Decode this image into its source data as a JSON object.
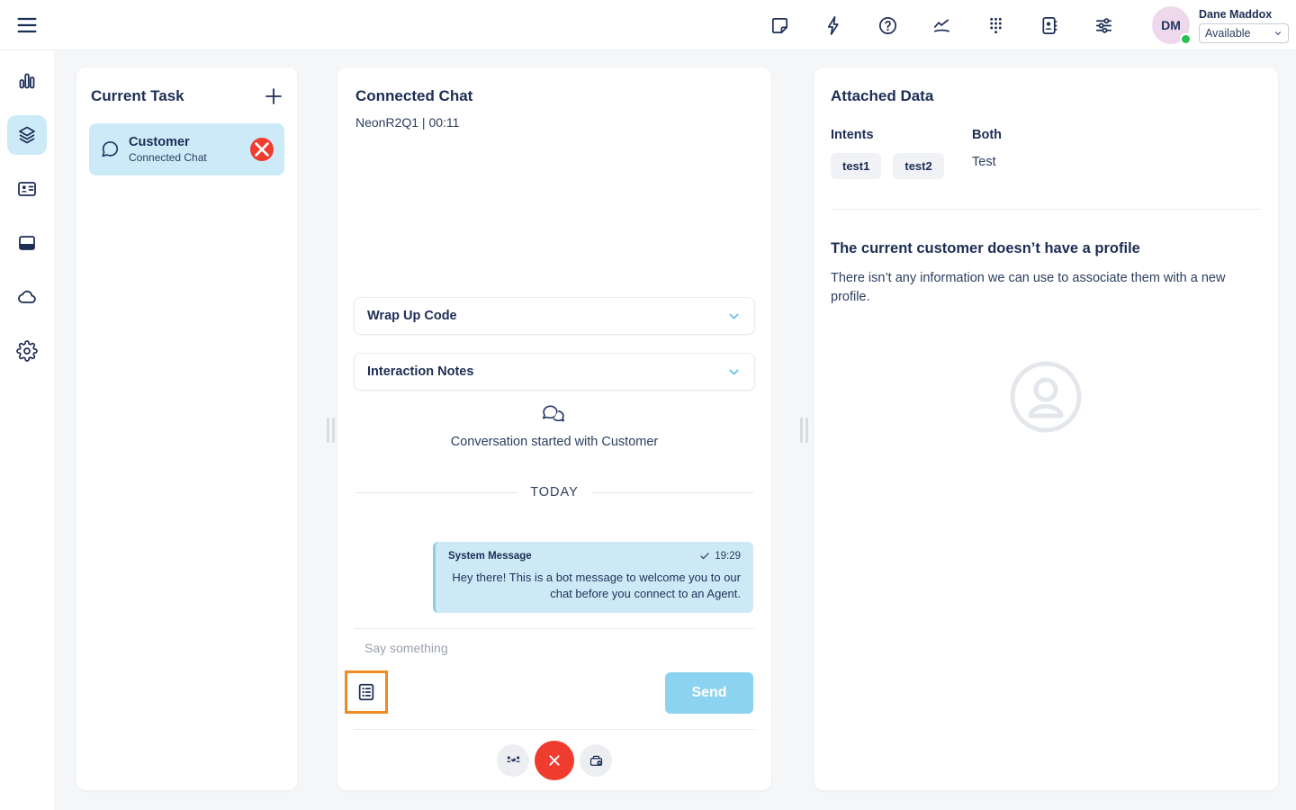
{
  "topbar": {
    "icons": [
      "menu",
      "note",
      "quick-actions",
      "help",
      "performance",
      "dialpad",
      "contacts",
      "preferences"
    ],
    "user": {
      "initials": "DM",
      "name": "Dane Maddox",
      "status": "Available"
    }
  },
  "sidebar": {
    "icons": [
      "activity",
      "interactions",
      "contact-card",
      "apps-window",
      "cloud",
      "settings"
    ],
    "active": "interactions"
  },
  "current_task": {
    "title": "Current Task",
    "task": {
      "name": "Customer",
      "type": "Connected Chat"
    }
  },
  "chat": {
    "title": "Connected Chat",
    "session_info": "NeonR2Q1 | 00:11",
    "wrap_up_label": "Wrap Up Code",
    "interaction_notes_label": "Interaction Notes",
    "conversation_started": "Conversation started with Customer",
    "day_divider": "TODAY",
    "message": {
      "sender": "System Message",
      "time": "19:29",
      "text": "Hey there! This is a bot message to welcome you to our chat before you connect to an Agent."
    },
    "input_placeholder": "Say something",
    "send_label": "Send"
  },
  "attached_data": {
    "title": "Attached Data",
    "intents_label": "Intents",
    "intents": [
      "test1",
      "test2"
    ],
    "both_label": "Both",
    "both_value": "Test",
    "no_profile_title": "The current customer doesn’t have a profile",
    "no_profile_text": "There isn’t any information we can use to associate them with a new profile."
  },
  "colors": {
    "accent_blue": "#8BD3F0",
    "selected_light_blue": "#CDEAF8",
    "highlight_orange": "#F08A24",
    "danger_red": "#F03C2E",
    "status_green": "#27C24C",
    "navy_text": "#1D2E55"
  }
}
